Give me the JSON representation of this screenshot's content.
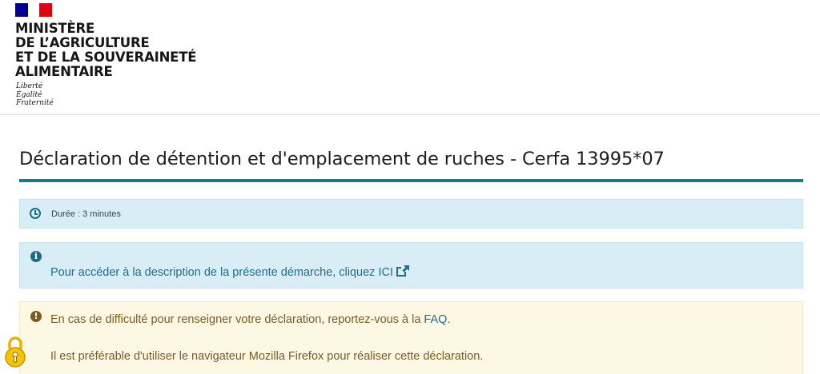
{
  "header": {
    "ministry_lines": [
      "MINISTÈRE",
      "DE L’AGRICULTURE",
      "ET DE LA SOUVERAINETÉ",
      "ALIMENTAIRE"
    ],
    "motto": [
      "Liberté",
      "Égalité",
      "Fraternité"
    ]
  },
  "page": {
    "title": "Déclaration de détention et d'emplacement de ruches - Cerfa 13995*07"
  },
  "duration_box": {
    "icon": "clock-icon",
    "text": "Durée : 3 minutes"
  },
  "info_box": {
    "icon": "info-circle-icon",
    "text": "Pour accéder à la description de la présente démarche, cliquez ICI",
    "link_icon": "external-link-icon"
  },
  "warning_box": {
    "icon": "exclamation-circle-icon",
    "line1_prefix": "En cas de difficulté pour renseigner votre déclaration, reportez-vous à la ",
    "faq_link": "FAQ",
    "line1_suffix": ".",
    "line2": "Il est préférable d'utiliser le navigateur Mozilla Firefox pour réaliser cette déclaration."
  },
  "colors": {
    "accent": "#117d8f",
    "info_bg": "#d9edf7",
    "info_text": "#1f6d8a",
    "warning_bg": "#fcf8e3",
    "warning_text": "#7d5b25",
    "flag_blue": "#000091",
    "flag_red": "#e1000f"
  },
  "floating_badge": {
    "icon": "padlock-badge-icon"
  }
}
